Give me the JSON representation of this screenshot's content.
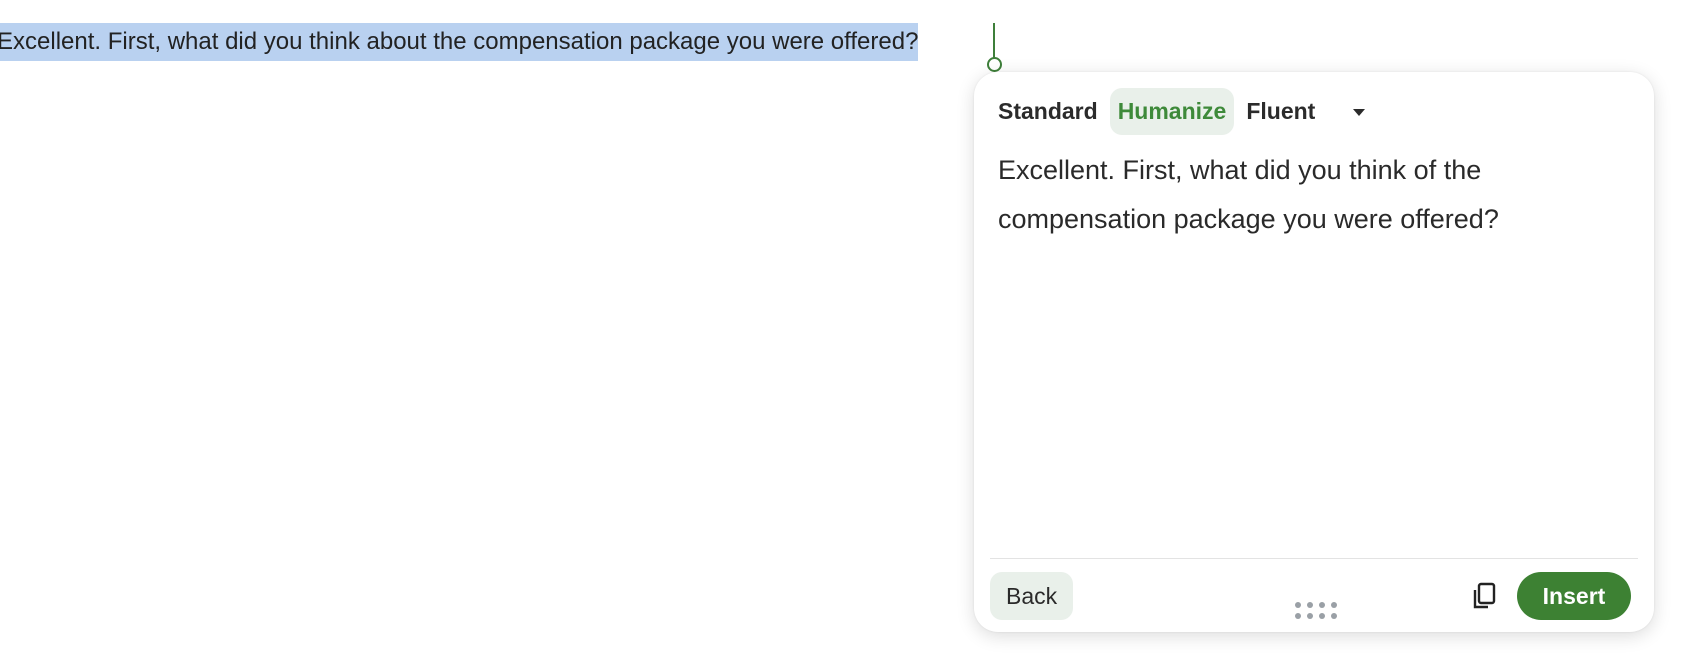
{
  "document": {
    "selected_text": "Excellent. First, what did you think about the compensation package you were offered?"
  },
  "panel": {
    "modes": [
      {
        "label": "Standard",
        "active": false
      },
      {
        "label": "Humanize",
        "active": true
      },
      {
        "label": "Fluent",
        "active": false
      }
    ],
    "dropdown_icon": "caret-down-icon",
    "result_text": "Excellent. First, what did you think of the compensation package you were offered?",
    "back_label": "Back",
    "copy_icon": "copy-icon",
    "drag_icon": "drag-handle-icon",
    "insert_label": "Insert"
  },
  "colors": {
    "accent": "#3d8133",
    "active_tab_text": "#3e8a3a",
    "active_tab_bg": "#e9f0ea",
    "selection": "#b9d1f0"
  }
}
